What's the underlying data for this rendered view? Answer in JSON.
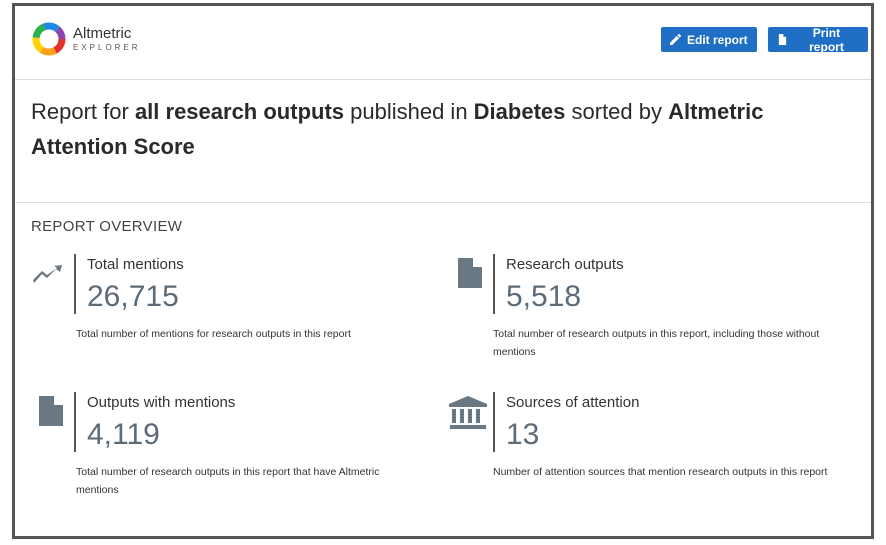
{
  "app": {
    "logo_name": "Altmetric",
    "logo_sub": "EXPLORER"
  },
  "toolbar": {
    "edit_label": "Edit report",
    "print_label": "Print report"
  },
  "report": {
    "title_prefix": "Report for ",
    "title_outputs": "all research outputs",
    "title_mid": " published in ",
    "title_subject": "Diabetes",
    "title_sorted": " sorted by ",
    "title_sort_key": "Altmetric Attention Score"
  },
  "overview": {
    "heading": "REPORT OVERVIEW",
    "metrics": [
      {
        "label": "Total mentions",
        "value": "26,715",
        "description": "Total number of mentions for research outputs in this report",
        "icon": "trend-line-icon"
      },
      {
        "label": "Research outputs",
        "value": "5,518",
        "description": "Total number of research outputs in this report, including those without mentions",
        "icon": "document-icon"
      },
      {
        "label": "Outputs with mentions",
        "value": "4,119",
        "description": "Total number of research outputs in this report that have Altmetric mentions",
        "icon": "document-icon"
      },
      {
        "label": "Sources of attention",
        "value": "13",
        "description": "Number of attention sources that mention research outputs in this report",
        "icon": "institution-icon"
      }
    ]
  },
  "colors": {
    "primary_button": "#1f6fc5",
    "metric_value": "#5d6b78",
    "icon": "#6a7884"
  }
}
